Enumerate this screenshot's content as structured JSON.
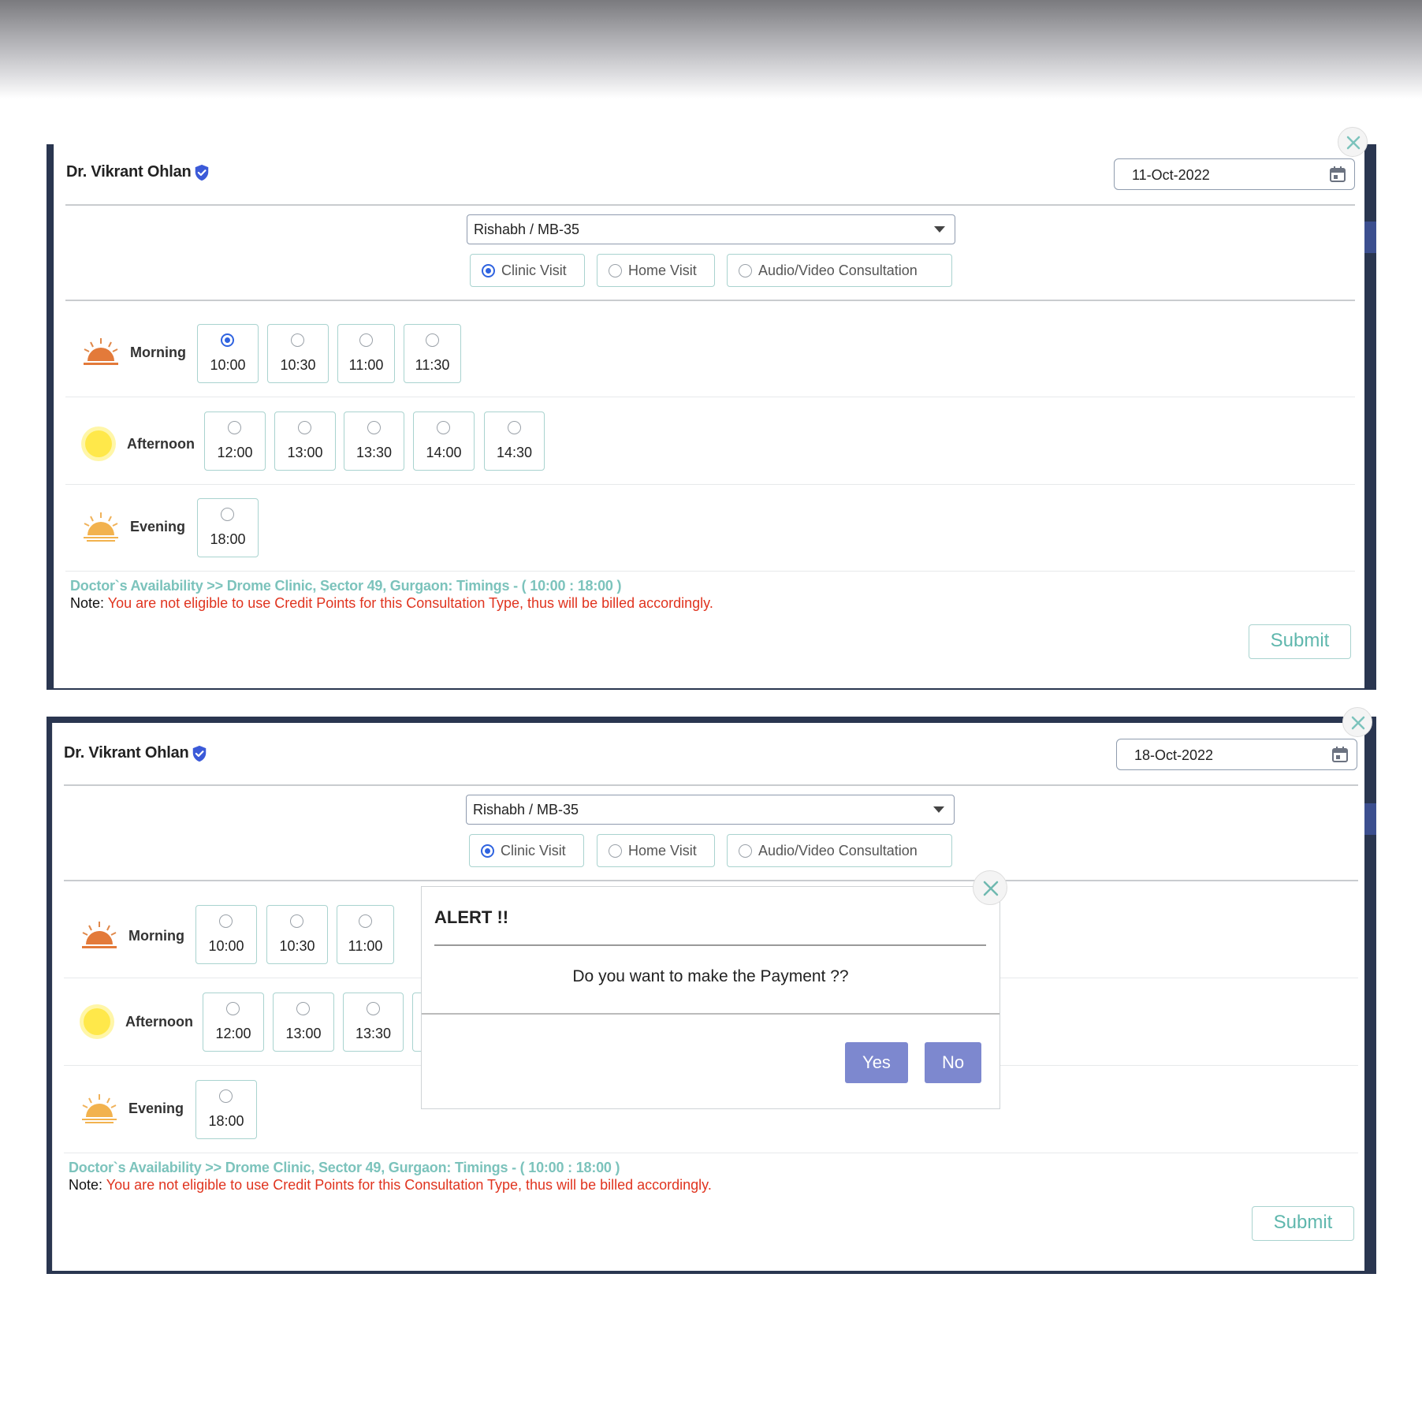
{
  "booking_1": {
    "doctor_name": "Dr. Vikrant Ohlan",
    "date": "11-Oct-2022",
    "patient": "Rishabh / MB-35",
    "visit_types": [
      "Clinic Visit",
      "Home Visit",
      "Audio/Video Consultation"
    ],
    "selected_visit_type": "Clinic Visit",
    "morning": {
      "label": "Morning",
      "slots": [
        "10:00",
        "10:30",
        "11:00",
        "11:30"
      ]
    },
    "afternoon": {
      "label": "Afternoon",
      "slots": [
        "12:00",
        "13:00",
        "13:30",
        "14:00",
        "14:30"
      ]
    },
    "evening": {
      "label": "Evening",
      "slots": [
        "18:00"
      ]
    },
    "selected_slot": "10:00",
    "availability": "Doctor`s Availability >> Drome Clinic, Sector 49, Gurgaon: Timings - ( 10:00 : 18:00 )",
    "note_label": "Note:",
    "note_text": "You are not eligible to use Credit Points for this Consultation Type, thus will be billed accordingly.",
    "submit_label": "Submit"
  },
  "booking_2": {
    "doctor_name": "Dr. Vikrant Ohlan",
    "date": "18-Oct-2022",
    "patient": "Rishabh / MB-35",
    "visit_types": [
      "Clinic Visit",
      "Home Visit",
      "Audio/Video Consultation"
    ],
    "selected_visit_type": "Clinic Visit",
    "morning": {
      "label": "Morning",
      "slots": [
        "10:00",
        "10:30",
        "11:00"
      ]
    },
    "afternoon": {
      "label": "Afternoon",
      "slots": [
        "12:00",
        "13:00",
        "13:30"
      ]
    },
    "evening": {
      "label": "Evening",
      "slots": [
        "18:00"
      ]
    },
    "selected_slot": "",
    "availability": "Doctor`s Availability >> Drome Clinic, Sector 49, Gurgaon: Timings - ( 10:00 : 18:00 )",
    "note_label": "Note:",
    "note_text": "You are not eligible to use Credit Points for this Consultation Type, thus will be billed accordingly.",
    "submit_label": "Submit"
  },
  "alert": {
    "title": "ALERT !!",
    "message": "Do you want to make the Payment ??",
    "yes_label": "Yes",
    "no_label": "No"
  },
  "icons": {
    "verified": "verified-badge-icon",
    "calendar": "calendar-icon",
    "morning": "sunrise-icon",
    "afternoon": "sun-icon",
    "evening": "sunset-icon",
    "close": "close-icon"
  },
  "colors": {
    "accent_teal": "#7cc3bc",
    "radio_selected": "#2f63e0",
    "warning_red": "#e0341f",
    "alert_button": "#7d88cf"
  }
}
